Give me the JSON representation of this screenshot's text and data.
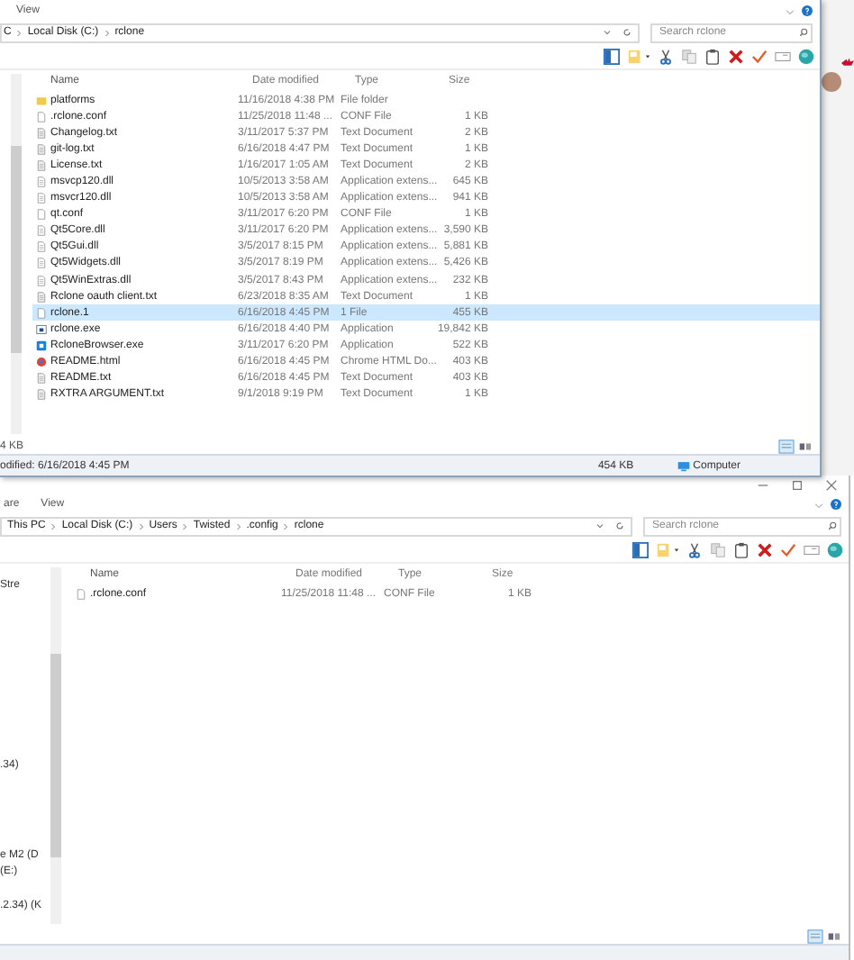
{
  "windows": [
    {
      "title_buttons": false,
      "menu": [
        "View"
      ],
      "address": [
        "C",
        "Local Disk (C:)",
        "rclone"
      ],
      "search": {
        "placeholder": "Search rclone"
      },
      "columns": [
        "Name",
        "Date modified",
        "Type",
        "Size"
      ],
      "rows": [
        {
          "kind": "folder",
          "name": "platforms",
          "date": "11/16/2018 4:38 PM",
          "type": "File folder",
          "size": "",
          "selected": false
        },
        {
          "kind": "file",
          "name": ".rclone.conf",
          "date": "11/25/2018 11:48 ...",
          "type": "CONF File",
          "size": "1 KB",
          "selected": false
        },
        {
          "kind": "text",
          "name": "Changelog.txt",
          "date": "3/11/2017 5:37 PM",
          "type": "Text Document",
          "size": "2 KB",
          "selected": false
        },
        {
          "kind": "text",
          "name": "git-log.txt",
          "date": "6/16/2018 4:47 PM",
          "type": "Text Document",
          "size": "1 KB",
          "selected": false
        },
        {
          "kind": "text",
          "name": "License.txt",
          "date": "1/16/2017 1:05 AM",
          "type": "Text Document",
          "size": "2 KB",
          "selected": false
        },
        {
          "kind": "dll",
          "name": "msvcp120.dll",
          "date": "10/5/2013 3:58 AM",
          "type": "Application extens...",
          "size": "645 KB",
          "selected": false
        },
        {
          "kind": "dll",
          "name": "msvcr120.dll",
          "date": "10/5/2013 3:58 AM",
          "type": "Application extens...",
          "size": "941 KB",
          "selected": false
        },
        {
          "kind": "file",
          "name": "qt.conf",
          "date": "3/11/2017 6:20 PM",
          "type": "CONF File",
          "size": "1 KB",
          "selected": false
        },
        {
          "kind": "dll",
          "name": "Qt5Core.dll",
          "date": "3/11/2017 6:20 PM",
          "type": "Application extens...",
          "size": "3,590 KB",
          "selected": false
        },
        {
          "kind": "dll",
          "name": "Qt5Gui.dll",
          "date": "3/5/2017 8:15 PM",
          "type": "Application extens...",
          "size": "5,881 KB",
          "selected": false
        },
        {
          "kind": "dll",
          "name": "Qt5Widgets.dll",
          "date": "3/5/2017 8:19 PM",
          "type": "Application extens...",
          "size": "5,426 KB",
          "selected": false
        },
        {
          "kind": "dll",
          "name": "Qt5WinExtras.dll",
          "date": "3/5/2017 8:43 PM",
          "type": "Application extens...",
          "size": "232 KB",
          "selected": false
        },
        {
          "kind": "text",
          "name": "Rclone oauth client.txt",
          "date": "6/23/2018 8:35 AM",
          "type": "Text Document",
          "size": "1 KB",
          "selected": false
        },
        {
          "kind": "file",
          "name": "rclone.1",
          "date": "6/16/2018 4:45 PM",
          "type": "1 File",
          "size": "455 KB",
          "selected": true
        },
        {
          "kind": "exe",
          "name": "rclone.exe",
          "date": "6/16/2018 4:40 PM",
          "type": "Application",
          "size": "19,842 KB",
          "selected": false
        },
        {
          "kind": "app",
          "name": "RcloneBrowser.exe",
          "date": "3/11/2017 6:20 PM",
          "type": "Application",
          "size": "522 KB",
          "selected": false
        },
        {
          "kind": "web",
          "name": "README.html",
          "date": "6/16/2018 4:45 PM",
          "type": "Chrome HTML Do...",
          "size": "403 KB",
          "selected": false
        },
        {
          "kind": "text",
          "name": "README.txt",
          "date": "6/16/2018 4:45 PM",
          "type": "Text Document",
          "size": "403 KB",
          "selected": false
        },
        {
          "kind": "text",
          "name": "RXTRA ARGUMENT.txt",
          "date": "9/1/2018 9:19 PM",
          "type": "Text Document",
          "size": "1 KB",
          "selected": false
        }
      ],
      "pane_note": "4 KB",
      "status": {
        "left": "odified: 6/16/2018 4:45 PM",
        "size": "454 KB",
        "zone": "Computer"
      }
    },
    {
      "title_buttons": true,
      "menu": [
        "are",
        "View"
      ],
      "address": [
        "This PC",
        "Local Disk (C:)",
        "Users",
        "Twisted",
        ".config",
        "rclone"
      ],
      "search": {
        "placeholder": "Search rclone"
      },
      "nav_items": [
        "Stre",
        ".34)",
        "e M2 (D",
        "(E:)",
        ".2.34) (K"
      ],
      "columns": [
        "Name",
        "Date modified",
        "Type",
        "Size"
      ],
      "rows": [
        {
          "kind": "file",
          "name": ".rclone.conf",
          "date": "11/25/2018 11:48 ...",
          "type": "CONF File",
          "size": "1 KB",
          "selected": false
        }
      ]
    }
  ]
}
